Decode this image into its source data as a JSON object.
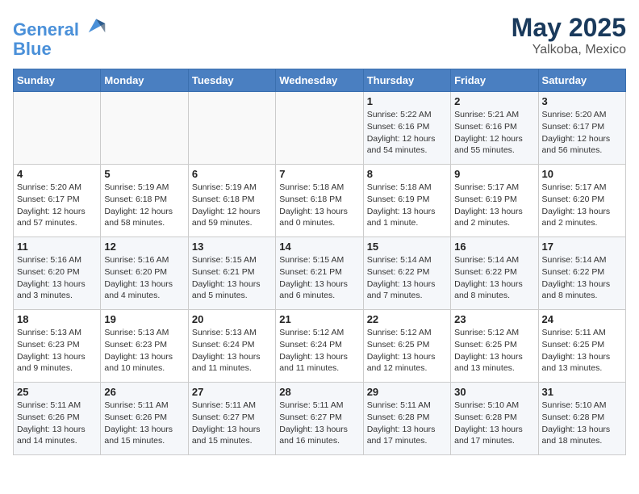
{
  "header": {
    "logo_line1": "General",
    "logo_line2": "Blue",
    "month_year": "May 2025",
    "location": "Yalkoba, Mexico"
  },
  "days_of_week": [
    "Sunday",
    "Monday",
    "Tuesday",
    "Wednesday",
    "Thursday",
    "Friday",
    "Saturday"
  ],
  "weeks": [
    [
      {
        "day": "",
        "info": ""
      },
      {
        "day": "",
        "info": ""
      },
      {
        "day": "",
        "info": ""
      },
      {
        "day": "",
        "info": ""
      },
      {
        "day": "1",
        "info": "Sunrise: 5:22 AM\nSunset: 6:16 PM\nDaylight: 12 hours\nand 54 minutes."
      },
      {
        "day": "2",
        "info": "Sunrise: 5:21 AM\nSunset: 6:16 PM\nDaylight: 12 hours\nand 55 minutes."
      },
      {
        "day": "3",
        "info": "Sunrise: 5:20 AM\nSunset: 6:17 PM\nDaylight: 12 hours\nand 56 minutes."
      }
    ],
    [
      {
        "day": "4",
        "info": "Sunrise: 5:20 AM\nSunset: 6:17 PM\nDaylight: 12 hours\nand 57 minutes."
      },
      {
        "day": "5",
        "info": "Sunrise: 5:19 AM\nSunset: 6:18 PM\nDaylight: 12 hours\nand 58 minutes."
      },
      {
        "day": "6",
        "info": "Sunrise: 5:19 AM\nSunset: 6:18 PM\nDaylight: 12 hours\nand 59 minutes."
      },
      {
        "day": "7",
        "info": "Sunrise: 5:18 AM\nSunset: 6:18 PM\nDaylight: 13 hours\nand 0 minutes."
      },
      {
        "day": "8",
        "info": "Sunrise: 5:18 AM\nSunset: 6:19 PM\nDaylight: 13 hours\nand 1 minute."
      },
      {
        "day": "9",
        "info": "Sunrise: 5:17 AM\nSunset: 6:19 PM\nDaylight: 13 hours\nand 2 minutes."
      },
      {
        "day": "10",
        "info": "Sunrise: 5:17 AM\nSunset: 6:20 PM\nDaylight: 13 hours\nand 2 minutes."
      }
    ],
    [
      {
        "day": "11",
        "info": "Sunrise: 5:16 AM\nSunset: 6:20 PM\nDaylight: 13 hours\nand 3 minutes."
      },
      {
        "day": "12",
        "info": "Sunrise: 5:16 AM\nSunset: 6:20 PM\nDaylight: 13 hours\nand 4 minutes."
      },
      {
        "day": "13",
        "info": "Sunrise: 5:15 AM\nSunset: 6:21 PM\nDaylight: 13 hours\nand 5 minutes."
      },
      {
        "day": "14",
        "info": "Sunrise: 5:15 AM\nSunset: 6:21 PM\nDaylight: 13 hours\nand 6 minutes."
      },
      {
        "day": "15",
        "info": "Sunrise: 5:14 AM\nSunset: 6:22 PM\nDaylight: 13 hours\nand 7 minutes."
      },
      {
        "day": "16",
        "info": "Sunrise: 5:14 AM\nSunset: 6:22 PM\nDaylight: 13 hours\nand 8 minutes."
      },
      {
        "day": "17",
        "info": "Sunrise: 5:14 AM\nSunset: 6:22 PM\nDaylight: 13 hours\nand 8 minutes."
      }
    ],
    [
      {
        "day": "18",
        "info": "Sunrise: 5:13 AM\nSunset: 6:23 PM\nDaylight: 13 hours\nand 9 minutes."
      },
      {
        "day": "19",
        "info": "Sunrise: 5:13 AM\nSunset: 6:23 PM\nDaylight: 13 hours\nand 10 minutes."
      },
      {
        "day": "20",
        "info": "Sunrise: 5:13 AM\nSunset: 6:24 PM\nDaylight: 13 hours\nand 11 minutes."
      },
      {
        "day": "21",
        "info": "Sunrise: 5:12 AM\nSunset: 6:24 PM\nDaylight: 13 hours\nand 11 minutes."
      },
      {
        "day": "22",
        "info": "Sunrise: 5:12 AM\nSunset: 6:25 PM\nDaylight: 13 hours\nand 12 minutes."
      },
      {
        "day": "23",
        "info": "Sunrise: 5:12 AM\nSunset: 6:25 PM\nDaylight: 13 hours\nand 13 minutes."
      },
      {
        "day": "24",
        "info": "Sunrise: 5:11 AM\nSunset: 6:25 PM\nDaylight: 13 hours\nand 13 minutes."
      }
    ],
    [
      {
        "day": "25",
        "info": "Sunrise: 5:11 AM\nSunset: 6:26 PM\nDaylight: 13 hours\nand 14 minutes."
      },
      {
        "day": "26",
        "info": "Sunrise: 5:11 AM\nSunset: 6:26 PM\nDaylight: 13 hours\nand 15 minutes."
      },
      {
        "day": "27",
        "info": "Sunrise: 5:11 AM\nSunset: 6:27 PM\nDaylight: 13 hours\nand 15 minutes."
      },
      {
        "day": "28",
        "info": "Sunrise: 5:11 AM\nSunset: 6:27 PM\nDaylight: 13 hours\nand 16 minutes."
      },
      {
        "day": "29",
        "info": "Sunrise: 5:11 AM\nSunset: 6:28 PM\nDaylight: 13 hours\nand 17 minutes."
      },
      {
        "day": "30",
        "info": "Sunrise: 5:10 AM\nSunset: 6:28 PM\nDaylight: 13 hours\nand 17 minutes."
      },
      {
        "day": "31",
        "info": "Sunrise: 5:10 AM\nSunset: 6:28 PM\nDaylight: 13 hours\nand 18 minutes."
      }
    ]
  ]
}
